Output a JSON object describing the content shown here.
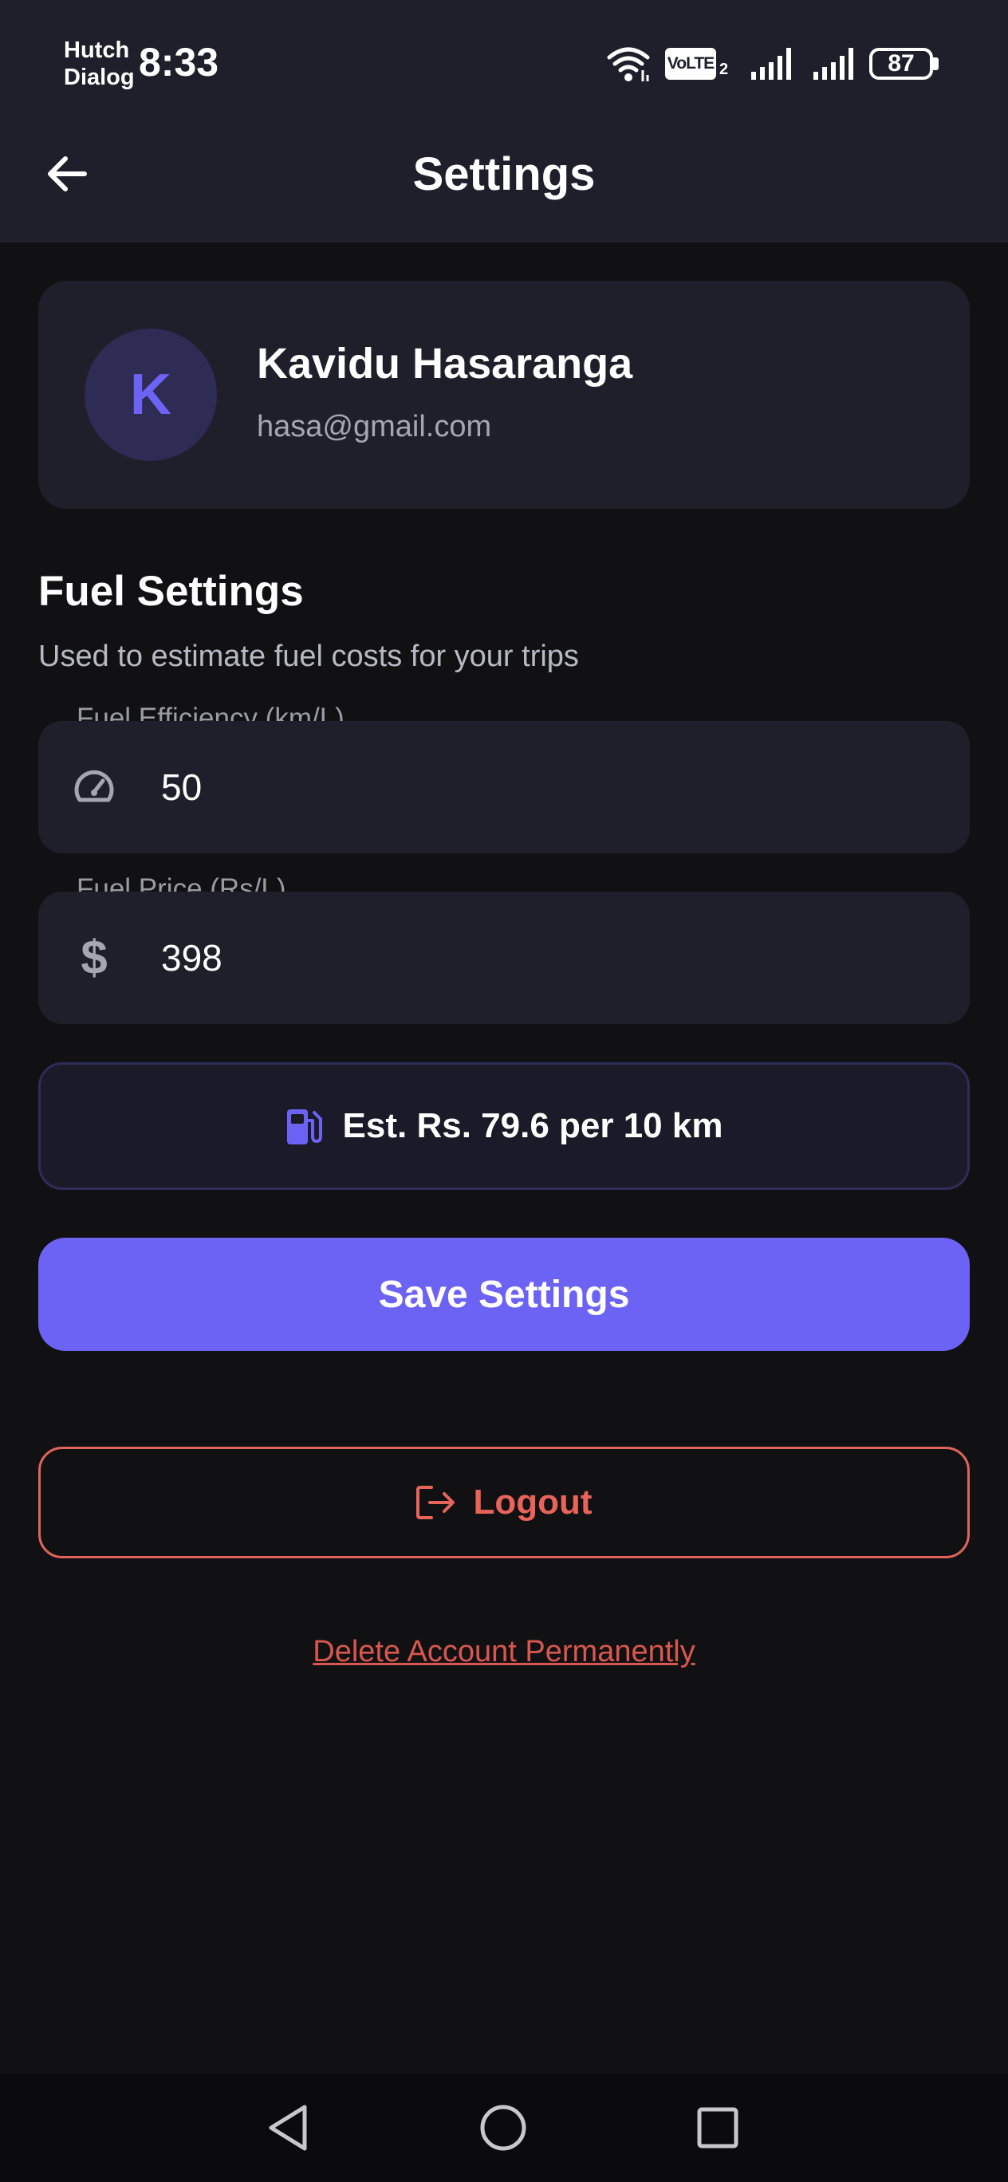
{
  "status_bar": {
    "carrier_line1": "Hutch",
    "carrier_line2": "Dialog",
    "time": "8:33",
    "volte": "VoLTE",
    "volte_sim": "2",
    "battery": "87",
    "icons": [
      "wifi-icon",
      "signal-icon",
      "signal-icon",
      "battery-icon"
    ]
  },
  "app_bar": {
    "back_icon": "arrow-left-icon",
    "title": "Settings"
  },
  "profile": {
    "initial": "K",
    "name": "Kavidu Hasaranga",
    "email": "hasa@gmail.com"
  },
  "fuel_settings": {
    "title": "Fuel Settings",
    "subtitle": "Used to estimate fuel costs for your trips",
    "efficiency": {
      "label": "Fuel Efficiency (km/L)",
      "value": "50",
      "icon": "speedometer-icon"
    },
    "price": {
      "label": "Fuel Price (Rs/L)",
      "value": "398",
      "icon": "dollar-icon"
    },
    "estimate": {
      "icon": "fuel-pump-icon",
      "text": "Est. Rs. 79.6 per 10 km"
    }
  },
  "actions": {
    "save_label": "Save Settings",
    "logout_label": "Logout",
    "logout_icon": "logout-icon",
    "delete_label": "Delete Account Permanently"
  },
  "nav_bar": {
    "icons": [
      "back-triangle-icon",
      "home-circle-icon",
      "recents-square-icon"
    ]
  },
  "colors": {
    "background": "#111113",
    "surface": "#1f1f2b",
    "accent": "#6c63f5",
    "danger": "#e8645a",
    "muted_text": "#a6a6b2"
  }
}
